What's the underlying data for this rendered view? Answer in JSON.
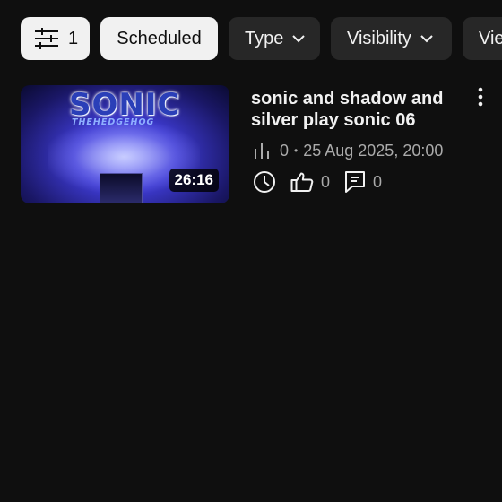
{
  "filters": {
    "filter_icon": "filter-sliders-icon",
    "filter_count": "1",
    "chips": [
      {
        "label": "Scheduled",
        "selected": true
      },
      {
        "label": "Type",
        "has_dropdown": true
      },
      {
        "label": "Visibility",
        "has_dropdown": true
      },
      {
        "label": "Vie"
      }
    ]
  },
  "video": {
    "title": "sonic and shadow and silver play sonic 06",
    "duration": "26:16",
    "views": "0",
    "date": "25 Aug 2025, 20:00",
    "likes": "0",
    "comments": "0",
    "thumbnail": {
      "logo": "SONIC",
      "logo_sub": "THEHEDGEHOG"
    },
    "icons": [
      "views-bars-icon",
      "clock-icon",
      "thumbs-up-icon",
      "comment-icon",
      "more-vert-icon"
    ]
  },
  "colors": {
    "background": "#0f0f0f",
    "chip": "#272727",
    "chip_selected": "#f1f1f1",
    "secondary_text": "#aaaaaa"
  }
}
